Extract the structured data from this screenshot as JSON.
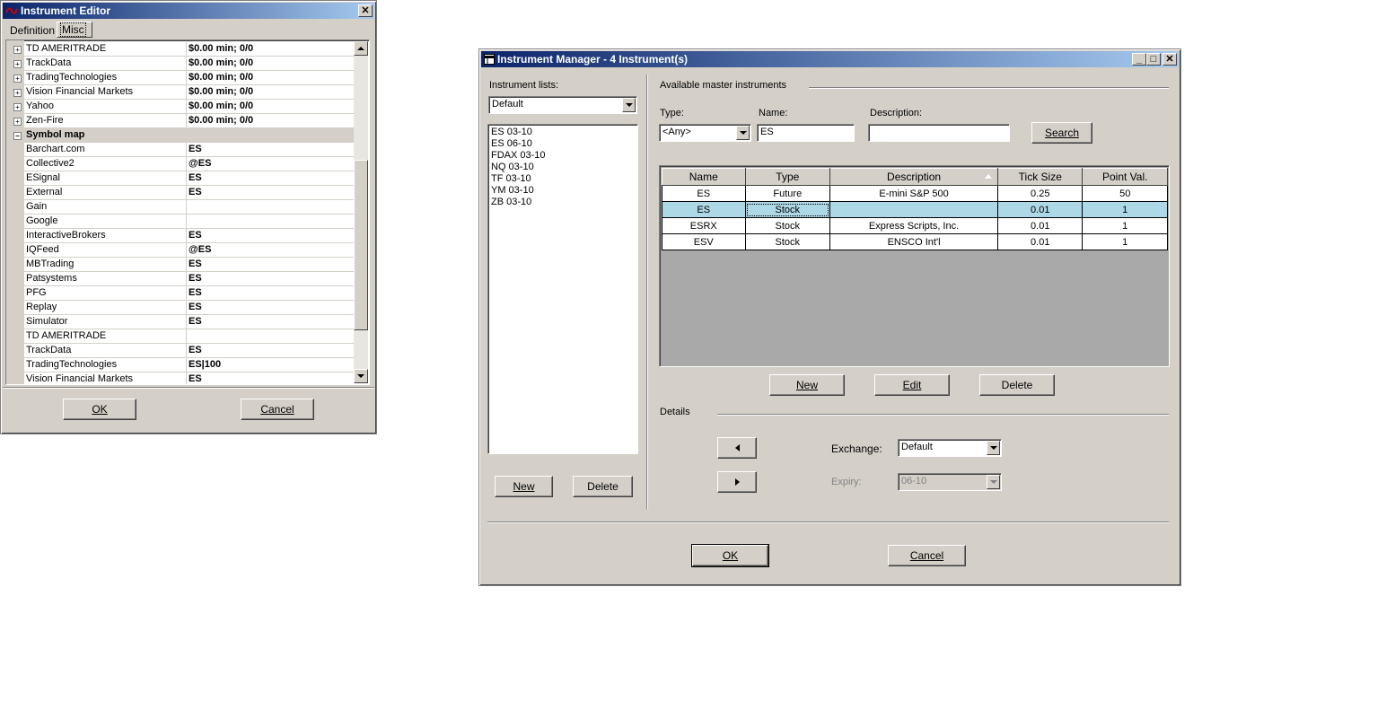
{
  "editor": {
    "title": "Instrument Editor",
    "tabs": [
      "Definition",
      "Misc"
    ],
    "rows": [
      {
        "name": "TD AMERITRADE",
        "value": "$0.00 min;  0/0",
        "type": "expand"
      },
      {
        "name": "TrackData",
        "value": "$0.00 min;  0/0",
        "type": "expand"
      },
      {
        "name": "TradingTechnologies",
        "value": "$0.00 min;  0/0",
        "type": "expand"
      },
      {
        "name": "Vision Financial Markets",
        "value": "$0.00 min;  0/0",
        "type": "expand"
      },
      {
        "name": "Yahoo",
        "value": "$0.00 min;  0/0",
        "type": "expand"
      },
      {
        "name": "Zen-Fire",
        "value": "$0.00 min;  0/0",
        "type": "expand"
      },
      {
        "name": "Symbol map",
        "value": "",
        "type": "category"
      },
      {
        "name": "Barchart.com",
        "value": "ES",
        "type": "item"
      },
      {
        "name": "Collective2",
        "value": "@ES",
        "type": "item"
      },
      {
        "name": "ESignal",
        "value": "ES",
        "type": "item"
      },
      {
        "name": "External",
        "value": "ES",
        "type": "item"
      },
      {
        "name": "Gain",
        "value": "",
        "type": "item"
      },
      {
        "name": "Google",
        "value": "",
        "type": "item"
      },
      {
        "name": "InteractiveBrokers",
        "value": "ES",
        "type": "item"
      },
      {
        "name": "IQFeed",
        "value": "@ES",
        "type": "item"
      },
      {
        "name": "MBTrading",
        "value": "ES",
        "type": "item"
      },
      {
        "name": "Patsystems",
        "value": "ES",
        "type": "item"
      },
      {
        "name": "PFG",
        "value": "ES",
        "type": "item"
      },
      {
        "name": "Replay",
        "value": "ES",
        "type": "item"
      },
      {
        "name": "Simulator",
        "value": "ES",
        "type": "item"
      },
      {
        "name": "TD AMERITRADE",
        "value": "",
        "type": "item"
      },
      {
        "name": "TrackData",
        "value": "ES",
        "type": "item"
      },
      {
        "name": "TradingTechnologies",
        "value": "ES|100",
        "type": "item"
      },
      {
        "name": "Vision Financial Markets",
        "value": "ES",
        "type": "item"
      }
    ],
    "ok_label": "OK",
    "cancel_label": "Cancel"
  },
  "manager": {
    "title": "Instrument Manager - 4 Instrument(s)",
    "instrument_lists_label": "Instrument lists:",
    "list_selected": "Default",
    "list_items": [
      "ES 03-10",
      "ES 06-10",
      "FDAX 03-10",
      "NQ 03-10",
      "TF 03-10",
      "YM 03-10",
      "ZB 03-10"
    ],
    "list_new_label": "New",
    "list_delete_label": "Delete",
    "available_label": "Available master instruments",
    "type_label": "Type:",
    "type_value": "<Any>",
    "name_label": "Name:",
    "name_value": "ES",
    "description_label": "Description:",
    "description_value": "",
    "search_label": "Search",
    "columns": [
      "Name",
      "Type",
      "Description",
      "Tick Size",
      "Point Val."
    ],
    "rows": [
      [
        "ES",
        "Future",
        "E-mini S&P 500",
        "0.25",
        "50"
      ],
      [
        "ES",
        "Stock",
        "",
        "0.01",
        "1"
      ],
      [
        "ESRX",
        "Stock",
        "Express Scripts, Inc.",
        "0.01",
        "1"
      ],
      [
        "ESV",
        "Stock",
        "ENSCO Int'l",
        "0.01",
        "1"
      ]
    ],
    "selected_row": 1,
    "new_label": "New",
    "edit_label": "Edit",
    "delete_label": "Delete",
    "details_label": "Details",
    "exchange_label": "Exchange:",
    "exchange_value": "Default",
    "expiry_label": "Expiry:",
    "expiry_value": "06-10",
    "ok_label": "OK",
    "cancel_label": "Cancel"
  },
  "colors": {
    "selected_row": "#add8e6",
    "title_start": "#0a246a",
    "title_end": "#a6caf0",
    "grid_empty": "#a9a9a9"
  }
}
